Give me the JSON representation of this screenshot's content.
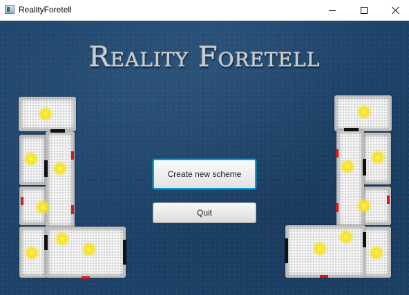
{
  "window": {
    "title": "RealityForetell",
    "icon": "app-window-icon",
    "controls": [
      "minimize-icon",
      "maximize-icon",
      "close-icon"
    ]
  },
  "main": {
    "game_title": "Reality Foretell",
    "create_button_label": "Create new scheme",
    "quit_button_label": "Quit"
  },
  "colors": {
    "background": "#1d4369",
    "focus_border": "#039ed3",
    "light": "#f7e21a",
    "door_red": "#d11a1a",
    "door_black": "#111111"
  }
}
